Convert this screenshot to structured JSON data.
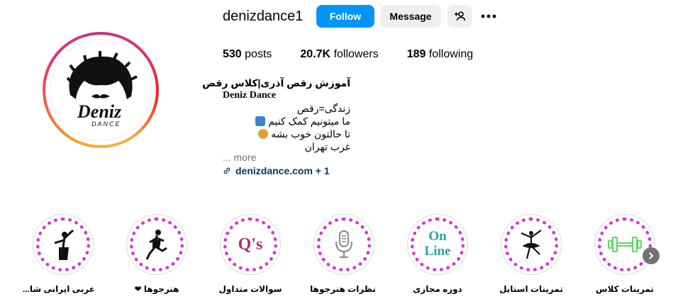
{
  "profile": {
    "username": "denizdance1",
    "follow_label": "Follow",
    "message_label": "Message",
    "add_user_icon": "add-person-icon",
    "more_icon": "more-options-icon",
    "avatar_text_main": "Deniz",
    "avatar_text_sub": "DANCE"
  },
  "stats": {
    "posts_count": "530",
    "posts_label": "posts",
    "followers_count": "20.7K",
    "followers_label": "followers",
    "following_count": "189",
    "following_label": "following"
  },
  "bio": {
    "line1": "آموزش رقص آذری|کلاس رقص",
    "name": "Deniz Dance",
    "line3": "زندگی=رقص",
    "line4": "ما میتونیم کمک کنیم",
    "line5": "تا حالتون خوب بشه",
    "line6": "غرب تهران",
    "more": "... more",
    "link": "denizdance.com + 1"
  },
  "highlights": [
    {
      "label": "تمرینات کلاس",
      "icon": "dumbbell-icon"
    },
    {
      "label": "تمرینات استایل",
      "icon": "ballerina-icon"
    },
    {
      "label": "دوره مجازی",
      "icon": "online-icon",
      "icon_text_1": "On",
      "icon_text_2": "Line"
    },
    {
      "label": "نظرات هنرجوها",
      "icon": "microphone-icon"
    },
    {
      "label": "سوالات متداول",
      "icon": "qs-icon",
      "icon_text": "Q's"
    },
    {
      "label": "هنرجوها ❤",
      "icon": "dancer-jump-icon"
    },
    {
      "label": "عربی ایرانی شا...",
      "icon": "dancer-pose-icon"
    }
  ],
  "colors": {
    "follow_blue": "#0095f6",
    "highlight_ring": "#d633d6",
    "link": "#00376b"
  }
}
